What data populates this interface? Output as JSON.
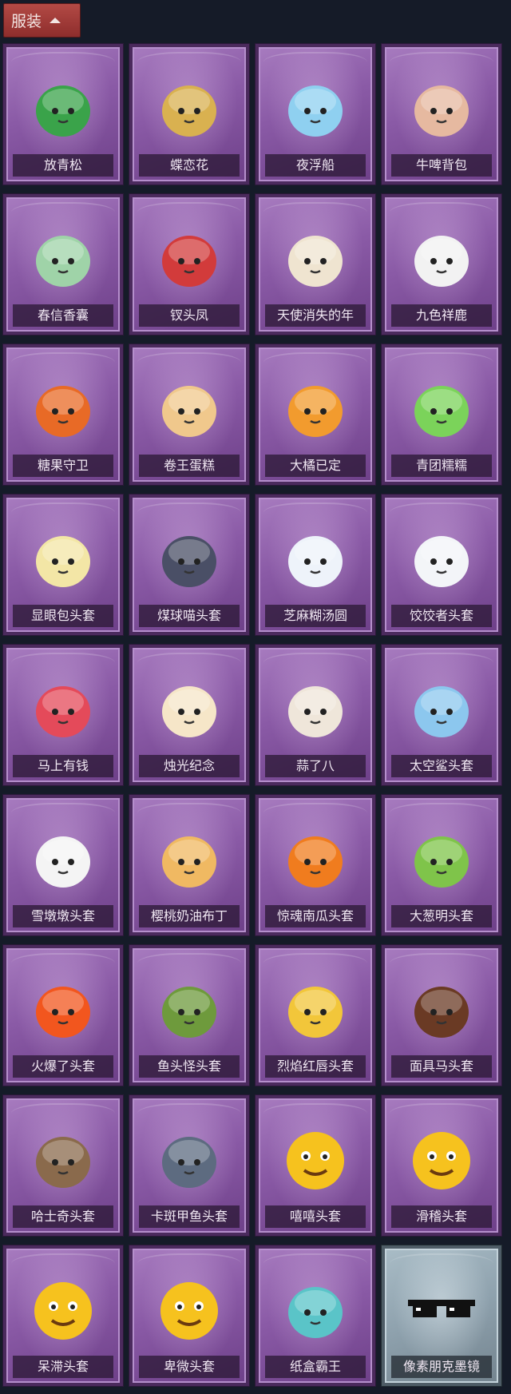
{
  "header": {
    "tab_label": "服装"
  },
  "items": [
    {
      "name": "放青松",
      "icon": "bonsai-tree-icon",
      "color": "#3aa34a"
    },
    {
      "name": "蝶恋花",
      "icon": "bell-ornament-icon",
      "color": "#d9b150"
    },
    {
      "name": "夜浮船",
      "icon": "jellyfish-icon",
      "color": "#8fd0f0"
    },
    {
      "name": "牛啤背包",
      "icon": "cow-beer-barrel-icon",
      "color": "#e6b9a0"
    },
    {
      "name": "春信香囊",
      "icon": "sachet-icon",
      "color": "#9fd3a8"
    },
    {
      "name": "钗头凤",
      "icon": "phoenix-crown-doll-icon",
      "color": "#d23b3b"
    },
    {
      "name": "天使消失的年",
      "icon": "angel-doll-icon",
      "color": "#efe4d0"
    },
    {
      "name": "九色祥鹿",
      "icon": "deer-icon",
      "color": "#f2f2f2"
    },
    {
      "name": "糖果守卫",
      "icon": "pumpkin-scarecrow-icon",
      "color": "#e86a26"
    },
    {
      "name": "卷王蛋糕",
      "icon": "roll-cake-icon",
      "color": "#f0c88c"
    },
    {
      "name": "大橘已定",
      "icon": "orange-slice-icon",
      "color": "#f29b2e"
    },
    {
      "name": "青团糯糯",
      "icon": "green-rice-ball-icon",
      "color": "#7bd35a"
    },
    {
      "name": "显眼包头套",
      "icon": "lightbulb-head-icon",
      "color": "#f3e6a6"
    },
    {
      "name": "煤球喵头套",
      "icon": "black-cat-head-icon",
      "color": "#4a4f66"
    },
    {
      "name": "芝麻糊汤圆",
      "icon": "tangyuan-head-icon",
      "color": "#eef3fa"
    },
    {
      "name": "饺饺者头套",
      "icon": "dumpling-head-icon",
      "color": "#f3f5f8"
    },
    {
      "name": "马上有钱",
      "icon": "red-horse-head-icon",
      "color": "#e44a5a"
    },
    {
      "name": "烛光纪念",
      "icon": "candle-head-icon",
      "color": "#f6e6c8"
    },
    {
      "name": "蒜了八",
      "icon": "garlic-head-icon",
      "color": "#efe6da"
    },
    {
      "name": "太空鲨头套",
      "icon": "shark-head-icon",
      "color": "#8cc7ee"
    },
    {
      "name": "雪墩墩头套",
      "icon": "snowman-head-icon",
      "color": "#f4f4f4"
    },
    {
      "name": "樱桃奶油布丁",
      "icon": "pudding-head-icon",
      "color": "#f0b962"
    },
    {
      "name": "惊魂南瓜头套",
      "icon": "jack-o-lantern-icon",
      "color": "#f07c1e"
    },
    {
      "name": "大葱明头套",
      "icon": "scallion-head-icon",
      "color": "#7fc44a"
    },
    {
      "name": "火爆了头套",
      "icon": "fire-head-icon",
      "color": "#f2561e"
    },
    {
      "name": "鱼头怪头套",
      "icon": "fish-head-icon",
      "color": "#6e9a3c"
    },
    {
      "name": "烈焰红唇头套",
      "icon": "pikachu-sunglasses-icon",
      "color": "#f2c63a"
    },
    {
      "name": "面具马头套",
      "icon": "horse-mask-icon",
      "color": "#6a3a24"
    },
    {
      "name": "哈士奇头套",
      "icon": "husky-head-icon",
      "color": "#8a6a4c"
    },
    {
      "name": "卡斑甲鱼头套",
      "icon": "whale-head-icon",
      "color": "#5d6b80"
    },
    {
      "name": "嘻嘻头套",
      "icon": "grin-emoji-icon",
      "color": "#f6c21e"
    },
    {
      "name": "滑稽头套",
      "icon": "funny-emoji-icon",
      "color": "#f6c21e"
    },
    {
      "name": "呆滞头套",
      "icon": "stunned-emoji-icon",
      "color": "#f6c21e"
    },
    {
      "name": "卑微头套",
      "icon": "humble-emoji-icon",
      "color": "#f6c21e"
    },
    {
      "name": "纸盒霸王",
      "icon": "box-dinosaur-icon",
      "color": "#5ac4c8"
    },
    {
      "name": "像素朋克墨镜",
      "icon": "pixel-sunglasses-icon",
      "color": "#111111",
      "special": true
    }
  ]
}
